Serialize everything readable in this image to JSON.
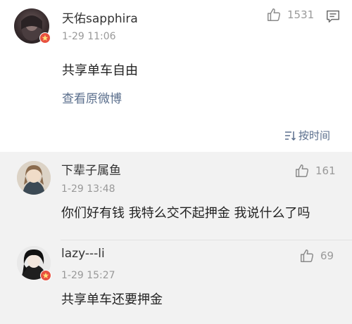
{
  "main_post": {
    "username": "天佑sapphira",
    "timestamp": "1-29 11:06",
    "likes": "1531",
    "content": "共享单车自由",
    "view_original": "查看原微博",
    "sort_label": "按时间"
  },
  "comments": [
    {
      "username": "下辈子属鱼",
      "timestamp": "1-29 13:48",
      "likes": "161",
      "content": "你们好有钱 我特么交不起押金 我说什么了吗"
    },
    {
      "username": "lazy---li",
      "timestamp": "1-29 15:27",
      "likes": "69",
      "content": "共享单车还要押金"
    }
  ],
  "colors": {
    "comment_bg": "#f2f2f2",
    "link": "#5a6e8c",
    "badge": "#e8503f"
  }
}
